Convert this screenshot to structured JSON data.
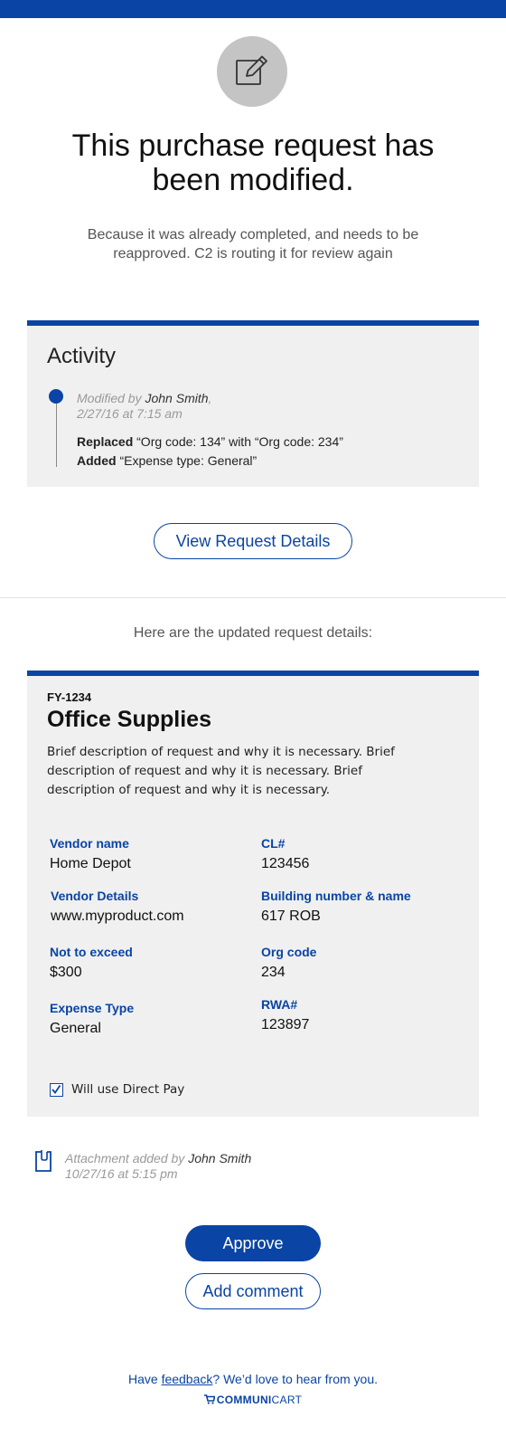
{
  "colors": {
    "accent": "#0a44a4",
    "panel": "#f0f0f0",
    "icon_circle": "#c4c4c4"
  },
  "header": {
    "icon": "pencil-edit-icon",
    "headline": "This purchase request has been modified.",
    "subtext": "Because it was already completed, and needs to be reapproved. C2 is routing it for review again"
  },
  "activity": {
    "title": "Activity",
    "entry": {
      "prefix": "Modified by ",
      "user": "John Smith",
      "suffix": ",",
      "timestamp": "2/27/16 at 7:15 am",
      "changes": [
        {
          "action": "Replaced",
          "text": " “Org code: 134” with “Org code: 234”"
        },
        {
          "action": "Added",
          "text": " “Expense type: General”"
        }
      ]
    }
  },
  "view_button": "View Request Details",
  "updated_text": "Here are the updated request details:",
  "request": {
    "id": "FY-1234",
    "title": "Office Supplies",
    "description": "Brief description of request and why it is necessary. Brief description of request and why it is necessary. Brief description of request and why it is necessary.",
    "fields": [
      {
        "label": "Vendor name",
        "value": "Home Depot"
      },
      {
        "label": "CL#",
        "value": "123456"
      },
      {
        "label": "Vendor Details",
        "value": "www.myproduct.com"
      },
      {
        "label": "Building number & name",
        "value": "617 ROB"
      },
      {
        "label": "Not to exceed",
        "value": "$300"
      },
      {
        "label": "Org code",
        "value": "234"
      },
      {
        "label": "Expense Type",
        "value": "General"
      },
      {
        "label": "RWA#",
        "value": "123897"
      }
    ],
    "direct_pay": {
      "checked": true,
      "label": "Will use Direct Pay"
    }
  },
  "attachment": {
    "icon": "attachment-clip-icon",
    "prefix": "Attachment added by ",
    "user": "John Smith",
    "timestamp": "10/27/16 at 5:15 pm"
  },
  "actions": {
    "approve": "Approve",
    "comment": "Add comment"
  },
  "footer": {
    "before": "Have ",
    "link": "feedback",
    "after": "? We’d love to hear from you.",
    "brand_icon": "cart-icon",
    "brand_bold": "COMMUNI",
    "brand_thin": "CART"
  }
}
